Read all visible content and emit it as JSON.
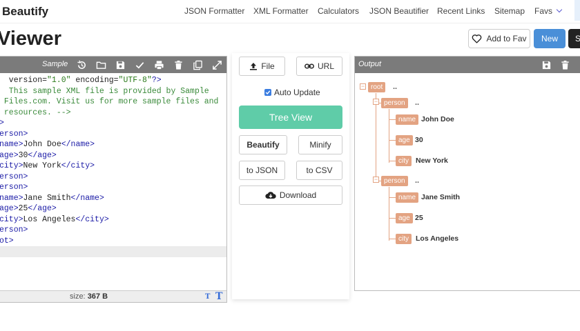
{
  "brand": "Beautify",
  "nav": [
    {
      "label": "JSON Formatter"
    },
    {
      "label": "XML Formatter"
    },
    {
      "label": "Calculators"
    },
    {
      "label": "JSON Beautifier"
    },
    {
      "label": "Recent Links"
    },
    {
      "label": "Sitemap"
    },
    {
      "label": "Favs"
    }
  ],
  "page_title": "Viewer",
  "actions": {
    "fav": "Add to Fav",
    "new": "New",
    "s": "S"
  },
  "editor": {
    "label": "Sample",
    "lines": [
      [
        {
          "c": "t-attr",
          "t": "  version="
        },
        {
          "c": "t-str",
          "t": "\"1.0\""
        },
        {
          "c": "t-attr",
          "t": " encoding="
        },
        {
          "c": "t-str",
          "t": "\"UTF-8\""
        },
        {
          "c": "t-tag",
          "t": "?>"
        }
      ],
      [
        {
          "c": "t-com",
          "t": "  This sample XML file is provided by Sample"
        }
      ],
      [
        {
          "c": "t-com",
          "t": " Files.com. Visit us for more sample files and"
        }
      ],
      [
        {
          "c": "t-com",
          "t": " resources. -->"
        }
      ],
      [
        {
          "c": "t-tag",
          "t": ">"
        }
      ],
      [
        {
          "c": "t-tag",
          "t": "erson>"
        }
      ],
      [
        {
          "c": "t-tag",
          "t": "name>"
        },
        {
          "c": "t-txt",
          "t": "John Doe"
        },
        {
          "c": "t-tag",
          "t": "</name>"
        }
      ],
      [
        {
          "c": "t-tag",
          "t": "age>"
        },
        {
          "c": "t-txt",
          "t": "30"
        },
        {
          "c": "t-tag",
          "t": "</age>"
        }
      ],
      [
        {
          "c": "t-tag",
          "t": "city>"
        },
        {
          "c": "t-txt",
          "t": "New York"
        },
        {
          "c": "t-tag",
          "t": "</city>"
        }
      ],
      [
        {
          "c": "t-tag",
          "t": "erson>"
        }
      ],
      [
        {
          "c": "t-tag",
          "t": "erson>"
        }
      ],
      [
        {
          "c": "t-tag",
          "t": "name>"
        },
        {
          "c": "t-txt",
          "t": "Jane Smith"
        },
        {
          "c": "t-tag",
          "t": "</name>"
        }
      ],
      [
        {
          "c": "t-tag",
          "t": "age>"
        },
        {
          "c": "t-txt",
          "t": "25"
        },
        {
          "c": "t-tag",
          "t": "</age>"
        }
      ],
      [
        {
          "c": "t-tag",
          "t": "city>"
        },
        {
          "c": "t-txt",
          "t": "Los Angeles"
        },
        {
          "c": "t-tag",
          "t": "</city>"
        }
      ],
      [
        {
          "c": "t-tag",
          "t": "erson>"
        }
      ],
      [
        {
          "c": "t-tag",
          "t": "ot>"
        }
      ],
      []
    ],
    "size_label": "size:",
    "size_value": "367 B"
  },
  "middle": {
    "file": "File",
    "url": "URL",
    "auto_update": "Auto Update",
    "auto_update_checked": true,
    "tree_view": "Tree View",
    "beautify": "Beautify",
    "minify": "Minify",
    "to_json": "to JSON",
    "to_csv": "to CSV",
    "download": "Download"
  },
  "output": {
    "label": "Output",
    "root": "root",
    "ellipsis": "..",
    "persons": [
      {
        "tag": "person",
        "fields": [
          {
            "k": "name",
            "v": "John Doe"
          },
          {
            "k": "age",
            "v": "30"
          },
          {
            "k": "city",
            "v": "New York"
          }
        ]
      },
      {
        "tag": "person",
        "fields": [
          {
            "k": "name",
            "v": "Jane Smith"
          },
          {
            "k": "age",
            "v": "25"
          },
          {
            "k": "city",
            "v": "Los Angeles"
          }
        ]
      }
    ]
  }
}
